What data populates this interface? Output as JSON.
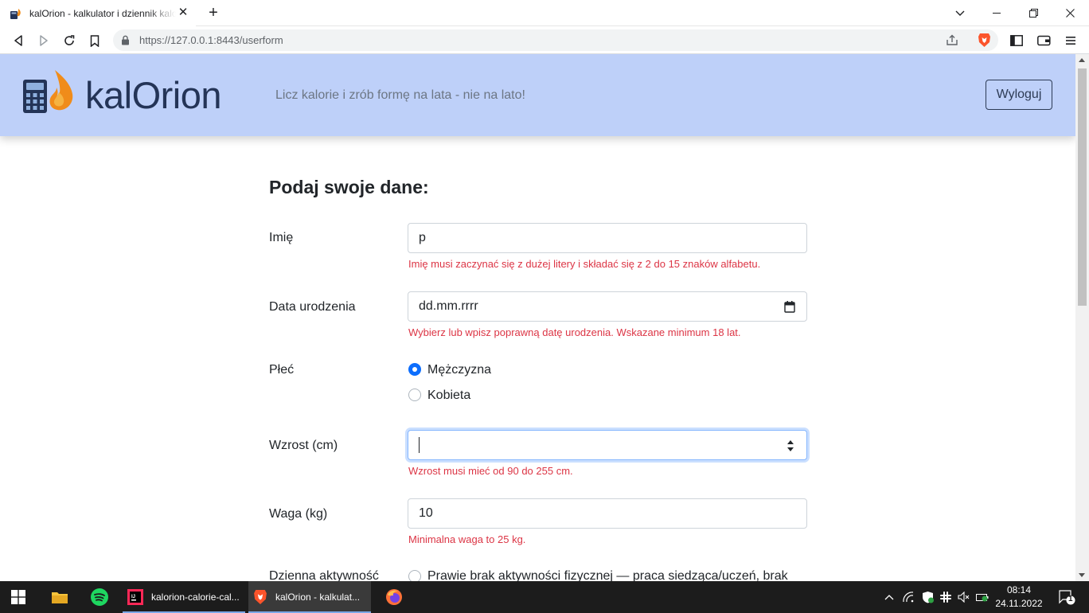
{
  "browser": {
    "tab_title": "kalOrion - kalkulator i dziennik kalorii",
    "url": "https://127.0.0.1:8443/userform"
  },
  "header": {
    "brand": "kalOrion",
    "tagline": "Licz kalorie i zrób formę na lata - nie na lato!",
    "logout_label": "Wyloguj"
  },
  "form": {
    "title": "Podaj swoje dane:",
    "name": {
      "label": "Imię",
      "value": "p",
      "error": "Imię musi zaczynać się z dużej litery i składać się z 2 do 15 znaków alfabetu."
    },
    "birthdate": {
      "label": "Data urodzenia",
      "value": "dd.mm.rrrr",
      "error": "Wybierz lub wpisz poprawną datę urodzenia. Wskazane minimum 18 lat."
    },
    "sex": {
      "label": "Płeć",
      "options": [
        "Mężczyzna",
        "Kobieta"
      ],
      "selected": "Mężczyzna"
    },
    "height": {
      "label": "Wzrost (cm)",
      "value": "",
      "error": "Wzrost musi mieć od 90 do 255 cm."
    },
    "weight": {
      "label": "Waga (kg)",
      "value": "10",
      "error": "Minimalna waga to 25 kg."
    },
    "activity": {
      "label": "Dzienna aktywność",
      "first_option": "Prawie brak aktywności fizycznej — praca siedząca/uczeń, brak"
    }
  },
  "taskbar": {
    "apps": [
      "kalorion-calorie-cal...",
      "kalOrion - kalkulat..."
    ],
    "time": "08:14",
    "date": "24.11.2022",
    "notifications": "1"
  },
  "colors": {
    "header_bg": "#bed0f9",
    "brand_text": "#243457",
    "error": "#dc3545",
    "radio_checked": "#0d6efd"
  }
}
